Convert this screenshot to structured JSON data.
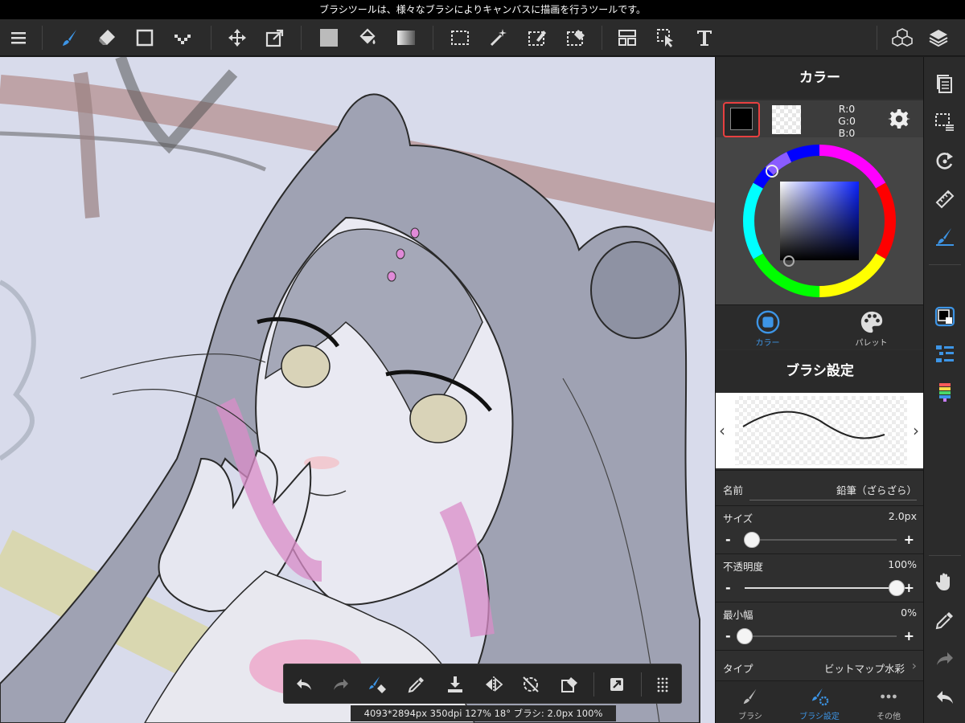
{
  "status_bar": {
    "message": "ブラシツールは、様々なブラシによりキャンバスに描画を行うツールです。"
  },
  "toolbar": {
    "tools": [
      "menu-icon",
      "brush-icon",
      "eraser-icon",
      "shape-icon",
      "dot-icon",
      "move-icon",
      "transform-icon",
      "fill-color-icon",
      "bucket-icon",
      "gradient-icon",
      "select-icon",
      "magic-wand-icon",
      "select-pen-icon",
      "select-eraser-icon",
      "frame-divider-icon",
      "operation-icon",
      "text-icon",
      "3d-material-icon",
      "layers-icon"
    ]
  },
  "colors": {
    "accent": "#3d95e6",
    "active_border": "#e84040",
    "panel_bg": "#2f2f2f",
    "canvas_bg": "#d9dcec"
  },
  "color_panel": {
    "title": "カラー",
    "rgb": {
      "r": "R:0",
      "g": "G:0",
      "b": "B:0"
    },
    "tabs": [
      {
        "label": "カラー",
        "active": true
      },
      {
        "label": "パレット",
        "active": false
      }
    ]
  },
  "brush_panel": {
    "title": "ブラシ設定",
    "name_label": "名前",
    "name_value": "鉛筆（ざらざら）",
    "size_label": "サイズ",
    "size_value": "2.0px",
    "size_level": 0.05,
    "opacity_label": "不透明度",
    "opacity_value": "100%",
    "opacity_level": 1.0,
    "min_width_label": "最小幅",
    "min_width_value": "0%",
    "min_width_level": 0.0,
    "type_label": "タイプ",
    "type_value": "ビットマップ水彩"
  },
  "bottom_tabs": [
    {
      "label": "ブラシ",
      "active": false
    },
    {
      "label": "ブラシ設定",
      "active": true
    },
    {
      "label": "その他",
      "active": false
    }
  ],
  "canvas_info": "4093*2894px 350dpi 127% 18° ブラシ: 2.0px 100%",
  "float_bar": {
    "tools": [
      "undo-icon",
      "redo-icon",
      "brush-eraser-toggle-icon",
      "eyedropper-icon",
      "import-icon",
      "flip-icon",
      "rotate-reset-icon",
      "clear-icon",
      "share-icon",
      "grid-icon"
    ]
  },
  "rail": {
    "tools": [
      "document-icon",
      "selection-layer-icon",
      "redo-circle-icon",
      "ruler-icon",
      "snap-icon",
      "color-swatch-icon",
      "brush-list-icon",
      "palette-bars-icon",
      "hand-icon",
      "eyedropper-rail-icon",
      "redo-rail-icon",
      "undo-rail-icon"
    ]
  }
}
